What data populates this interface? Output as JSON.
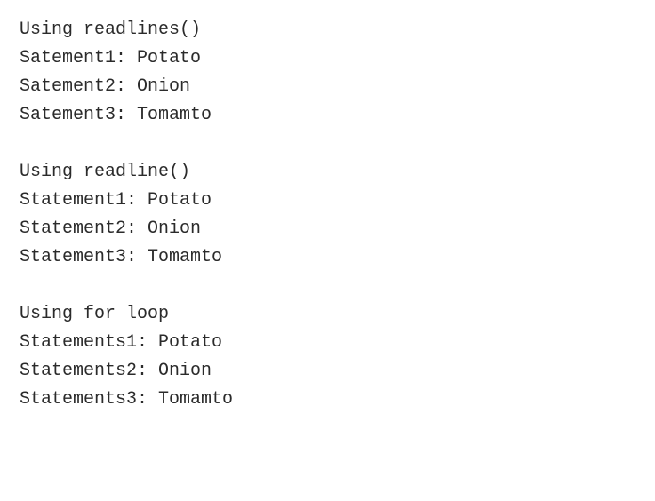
{
  "blocks": [
    {
      "header": "Using readlines()",
      "lines": [
        "Satement1: Potato",
        "Satement2: Onion",
        "Satement3: Tomamto"
      ]
    },
    {
      "header": "Using readline()",
      "lines": [
        "Statement1: Potato",
        "Statement2: Onion",
        "Statement3: Tomamto"
      ]
    },
    {
      "header": "Using for loop",
      "lines": [
        "Statements1: Potato",
        "Statements2: Onion",
        "Statements3: Tomamto"
      ]
    }
  ]
}
